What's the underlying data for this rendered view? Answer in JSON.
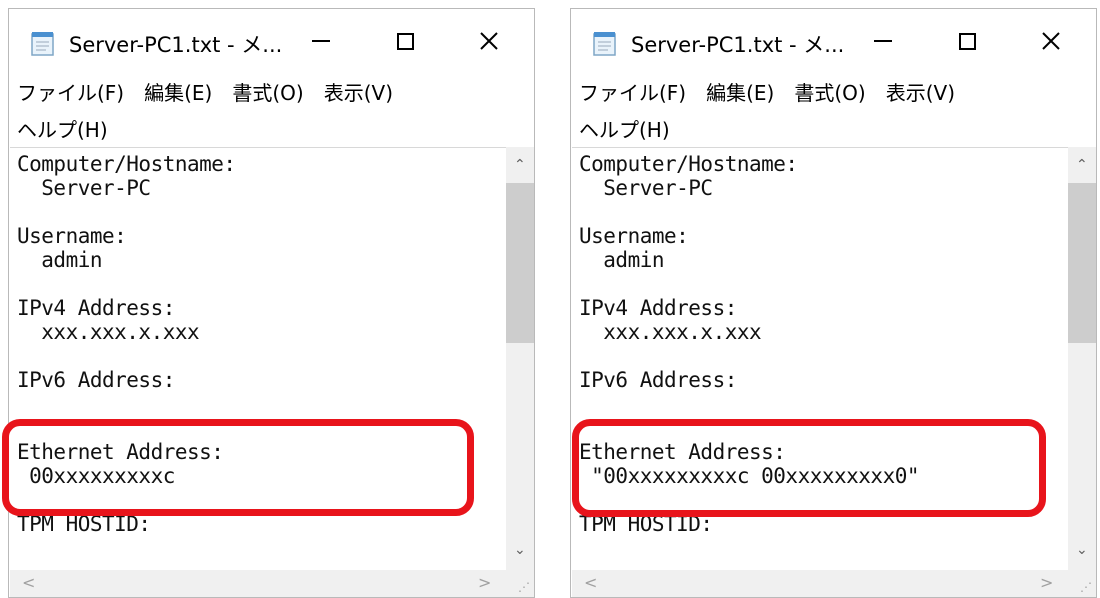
{
  "windows": [
    {
      "title": "Server-PC1.txt - メ...",
      "menu": [
        "ファイル(F)",
        "編集(E)",
        "書式(O)",
        "表示(V)",
        "ヘルプ(H)"
      ],
      "lines": [
        "Computer/Hostname:",
        "  Server-PC",
        "",
        "Username:",
        "  admin",
        "",
        "IPv4 Address:",
        "  xxx.xxx.x.xxx",
        "",
        "IPv6 Address:",
        "",
        "",
        "Ethernet Address:",
        " 00xxxxxxxxxc",
        "",
        "TPM HOSTID:"
      ]
    },
    {
      "title": "Server-PC1.txt - メ...",
      "menu": [
        "ファイル(F)",
        "編集(E)",
        "書式(O)",
        "表示(V)",
        "ヘルプ(H)"
      ],
      "lines": [
        "Computer/Hostname:",
        "  Server-PC",
        "",
        "Username:",
        "  admin",
        "",
        "IPv4 Address:",
        "  xxx.xxx.x.xxx",
        "",
        "IPv6 Address:",
        "",
        "",
        "Ethernet Address:",
        " \"00xxxxxxxxxc 00xxxxxxxxx0\"",
        "",
        "TPM HOSTID:"
      ]
    }
  ],
  "colors": {
    "highlight": "#e8141b"
  },
  "icons": {
    "app": "notepad-icon",
    "minimize": "minimize-icon",
    "maximize": "maximize-icon",
    "close": "close-icon"
  }
}
